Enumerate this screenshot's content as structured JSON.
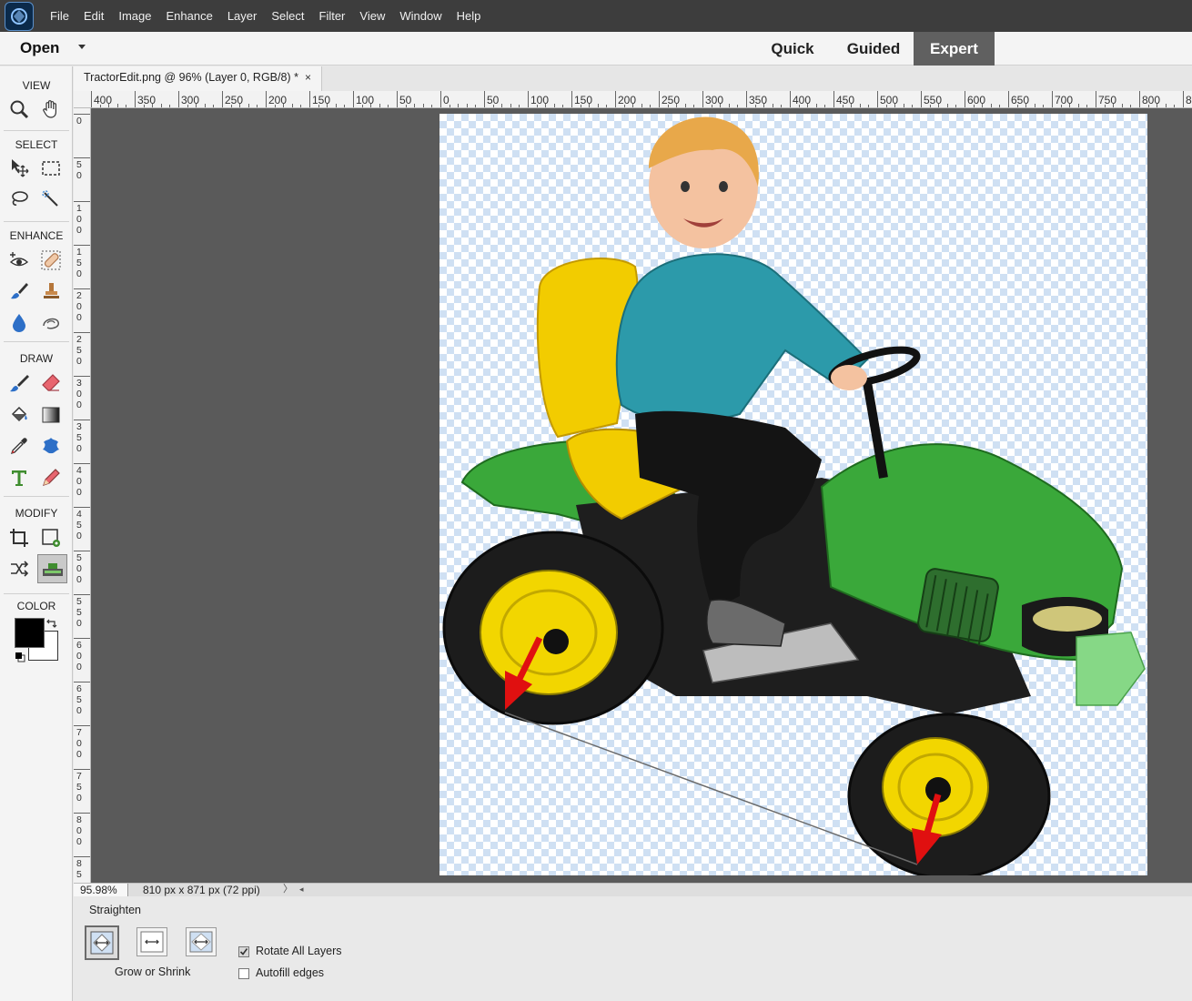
{
  "menu": {
    "items": [
      "File",
      "Edit",
      "Image",
      "Enhance",
      "Layer",
      "Select",
      "Filter",
      "View",
      "Window",
      "Help"
    ]
  },
  "modebar": {
    "open_label": "Open",
    "tabs": [
      "Quick",
      "Guided",
      "Expert"
    ],
    "active_tab": "Expert"
  },
  "toolbox": {
    "sections": [
      "VIEW",
      "SELECT",
      "ENHANCE",
      "DRAW",
      "MODIFY",
      "COLOR"
    ],
    "active_tool": "straighten-tool",
    "foreground_color": "#000000",
    "background_color": "#ffffff"
  },
  "document": {
    "tab_title": "TractorEdit.png @ 96% (Layer 0, RGB/8) *",
    "close_glyph": "×"
  },
  "rulers": {
    "horizontal": [
      "400",
      "350",
      "300",
      "250",
      "200",
      "150",
      "100",
      "50",
      "0",
      "50",
      "100",
      "150",
      "200",
      "250",
      "300",
      "350",
      "400",
      "450",
      "500",
      "550",
      "600",
      "650",
      "700",
      "750",
      "800",
      "8"
    ],
    "vertical": [
      "0",
      "50",
      "100",
      "150",
      "200",
      "250",
      "300",
      "350",
      "400",
      "450",
      "500",
      "550",
      "600",
      "650",
      "700",
      "750",
      "800",
      "85"
    ]
  },
  "status": {
    "zoom": "95.98%",
    "doc_size": "810 px x 871 px (72 ppi)",
    "more_arrow": "〉",
    "scroll_arrow": "◂"
  },
  "options": {
    "title": "Straighten",
    "mode_label": "Grow or Shrink",
    "rotate_all_layers": {
      "label": "Rotate All Layers",
      "checked": true
    },
    "autofill_edges": {
      "label": "Autofill edges",
      "checked": false
    }
  },
  "canvas": {
    "checker_color": "#cfe0f3",
    "tractor_green": "#3aa83a",
    "wheel_yellow": "#f2d600",
    "arrow_red": "#e01010"
  }
}
